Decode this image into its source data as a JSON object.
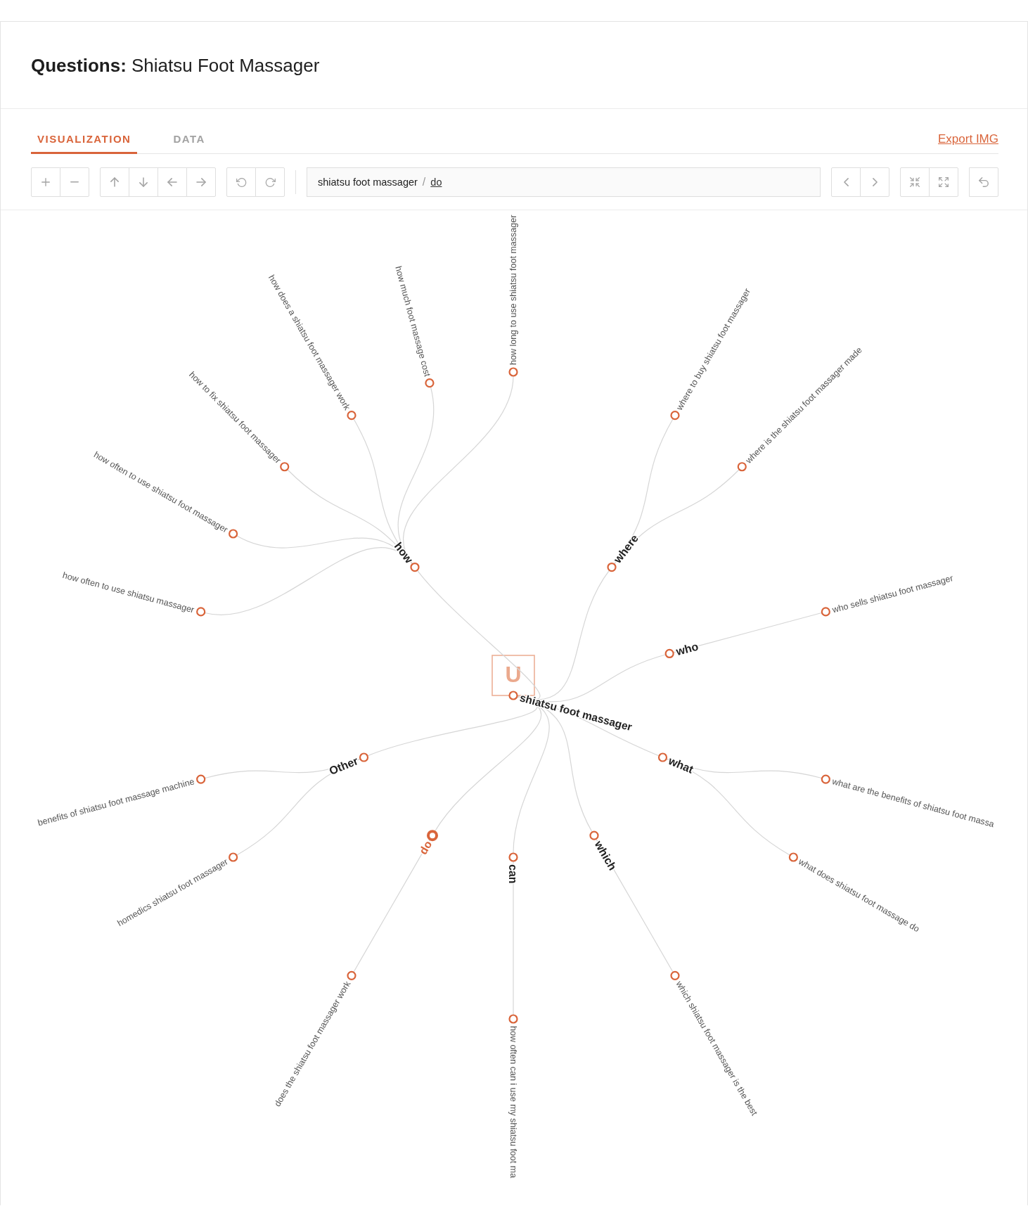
{
  "title": "**Questions:** Shiatsu Foot Massager",
  "tabs": [
    {
      "label": "VISUALIZATION",
      "selected": true
    },
    {
      "label": "DATA",
      "selected": false
    }
  ],
  "export_link": "Export IMG",
  "breadcrumb": {
    "items": [
      {
        "label": "shiatsu foot massager",
        "kind": "text"
      },
      {
        "label": "do",
        "kind": "link"
      }
    ],
    "separator": "/"
  },
  "tree": {
    "label": "shiatsu foot massager",
    "badge": "U",
    "selected": false,
    "children": [
      {
        "label": "how",
        "selected": false,
        "children": [
          {
            "label": "how often to use shiatsu massager",
            "selected": false
          },
          {
            "label": "how often to use shiatsu foot massager",
            "selected": false
          },
          {
            "label": "how to fix shiatsu foot massager",
            "selected": false
          },
          {
            "label": "how does a shiatsu foot massager work",
            "selected": false
          },
          {
            "label": "how much foot massage cost",
            "selected": false
          },
          {
            "label": "how long to use shiatsu foot massager",
            "selected": false
          }
        ]
      },
      {
        "label": "where",
        "selected": false,
        "children": [
          {
            "label": "where to buy shiatsu foot massager",
            "selected": false
          },
          {
            "label": "where is the shiatsu foot massager made",
            "selected": false
          }
        ]
      },
      {
        "label": "who",
        "selected": false,
        "children": [
          {
            "label": "who sells shiatsu foot massager",
            "selected": false
          }
        ]
      },
      {
        "label": "what",
        "selected": false,
        "children": [
          {
            "label": "what are the benefits of shiatsu foot massa",
            "selected": false
          },
          {
            "label": "what does shiatsu foot massage do",
            "selected": false
          }
        ]
      },
      {
        "label": "which",
        "selected": false,
        "children": [
          {
            "label": "which shiatsu foot massager is the best",
            "selected": false
          }
        ]
      },
      {
        "label": "can",
        "selected": false,
        "children": [
          {
            "label": "how often can i use my shiatsu foot ma",
            "selected": false
          }
        ]
      },
      {
        "label": "do",
        "selected": true,
        "children": [
          {
            "label": "does the shiatsu foot massager work",
            "selected": false
          }
        ]
      },
      {
        "label": "Other",
        "selected": false,
        "children": [
          {
            "label": "homedics shiatsu foot massager",
            "selected": false
          },
          {
            "label": "benefits of shiatsu foot massage machine",
            "selected": false
          }
        ]
      }
    ]
  }
}
